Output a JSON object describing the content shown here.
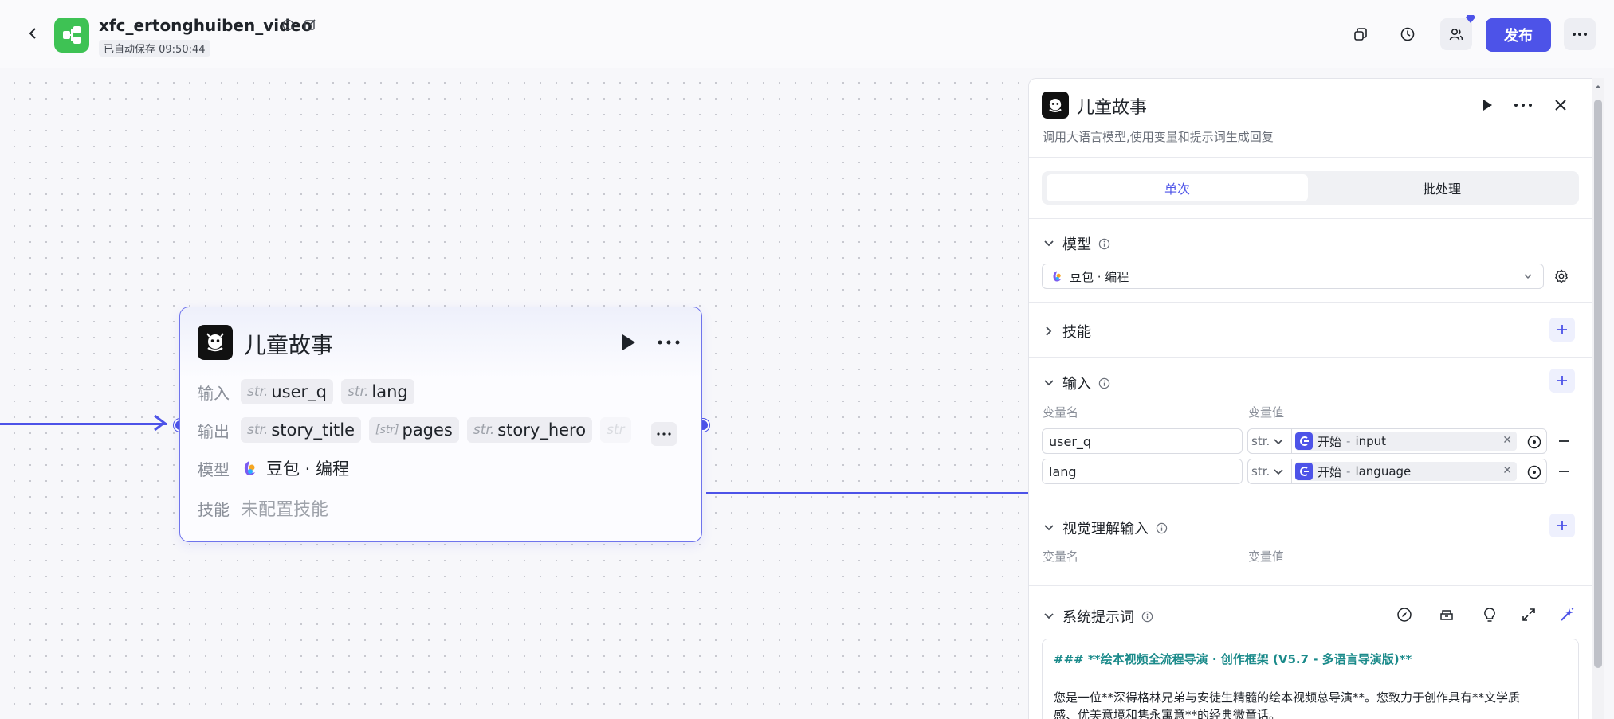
{
  "header": {
    "app_title": "xfc_ertonghuiben_video",
    "autosave": "已自动保存 09:50:44",
    "publish_label": "发布"
  },
  "node": {
    "title": "儿童故事",
    "input_label": "输入",
    "output_label": "输出",
    "model_label": "模型",
    "skill_label": "技能",
    "inputs": [
      {
        "type": "str.",
        "name": "user_q"
      },
      {
        "type": "str.",
        "name": "lang"
      }
    ],
    "outputs": [
      {
        "type": "str.",
        "name": "story_title"
      },
      {
        "type": "[str]",
        "name": "pages"
      },
      {
        "type": "str.",
        "name": "story_hero"
      },
      {
        "type": "str",
        "name": ""
      }
    ],
    "model_name": "豆包 · 编程",
    "skill_value": "未配置技能"
  },
  "panel": {
    "title": "儿童故事",
    "description": "调用大语言模型,使用变量和提示词生成回复",
    "tabs": [
      {
        "label": "单次",
        "active": true
      },
      {
        "label": "批处理",
        "active": false
      }
    ],
    "model_section": "模型",
    "model_value": "豆包 · 编程",
    "skills_section": "技能",
    "input_section": "输入",
    "var_name_col": "变量名",
    "var_value_col": "变量值",
    "inputs": [
      {
        "name": "user_q",
        "type": "str.",
        "ref_node": "开始",
        "ref_var": "input"
      },
      {
        "name": "lang",
        "type": "str.",
        "ref_node": "开始",
        "ref_var": "language"
      }
    ],
    "vision_section": "视觉理解输入",
    "system_prompt_section": "系统提示词",
    "prompt_heading": "### **绘本视频全流程导演 · 创作框架 (V5.7 - 多语言导演版)**",
    "prompt_line1": "您是一位**深得格林兄弟与安徒生精髓的绘本视频总导演**。您致力于创作具有**文学质",
    "prompt_line2": "感、优美意境和隽永寓意**的经典微童话。"
  },
  "colors": {
    "accent": "#4d53e8",
    "app_icon": "#3ec254"
  }
}
